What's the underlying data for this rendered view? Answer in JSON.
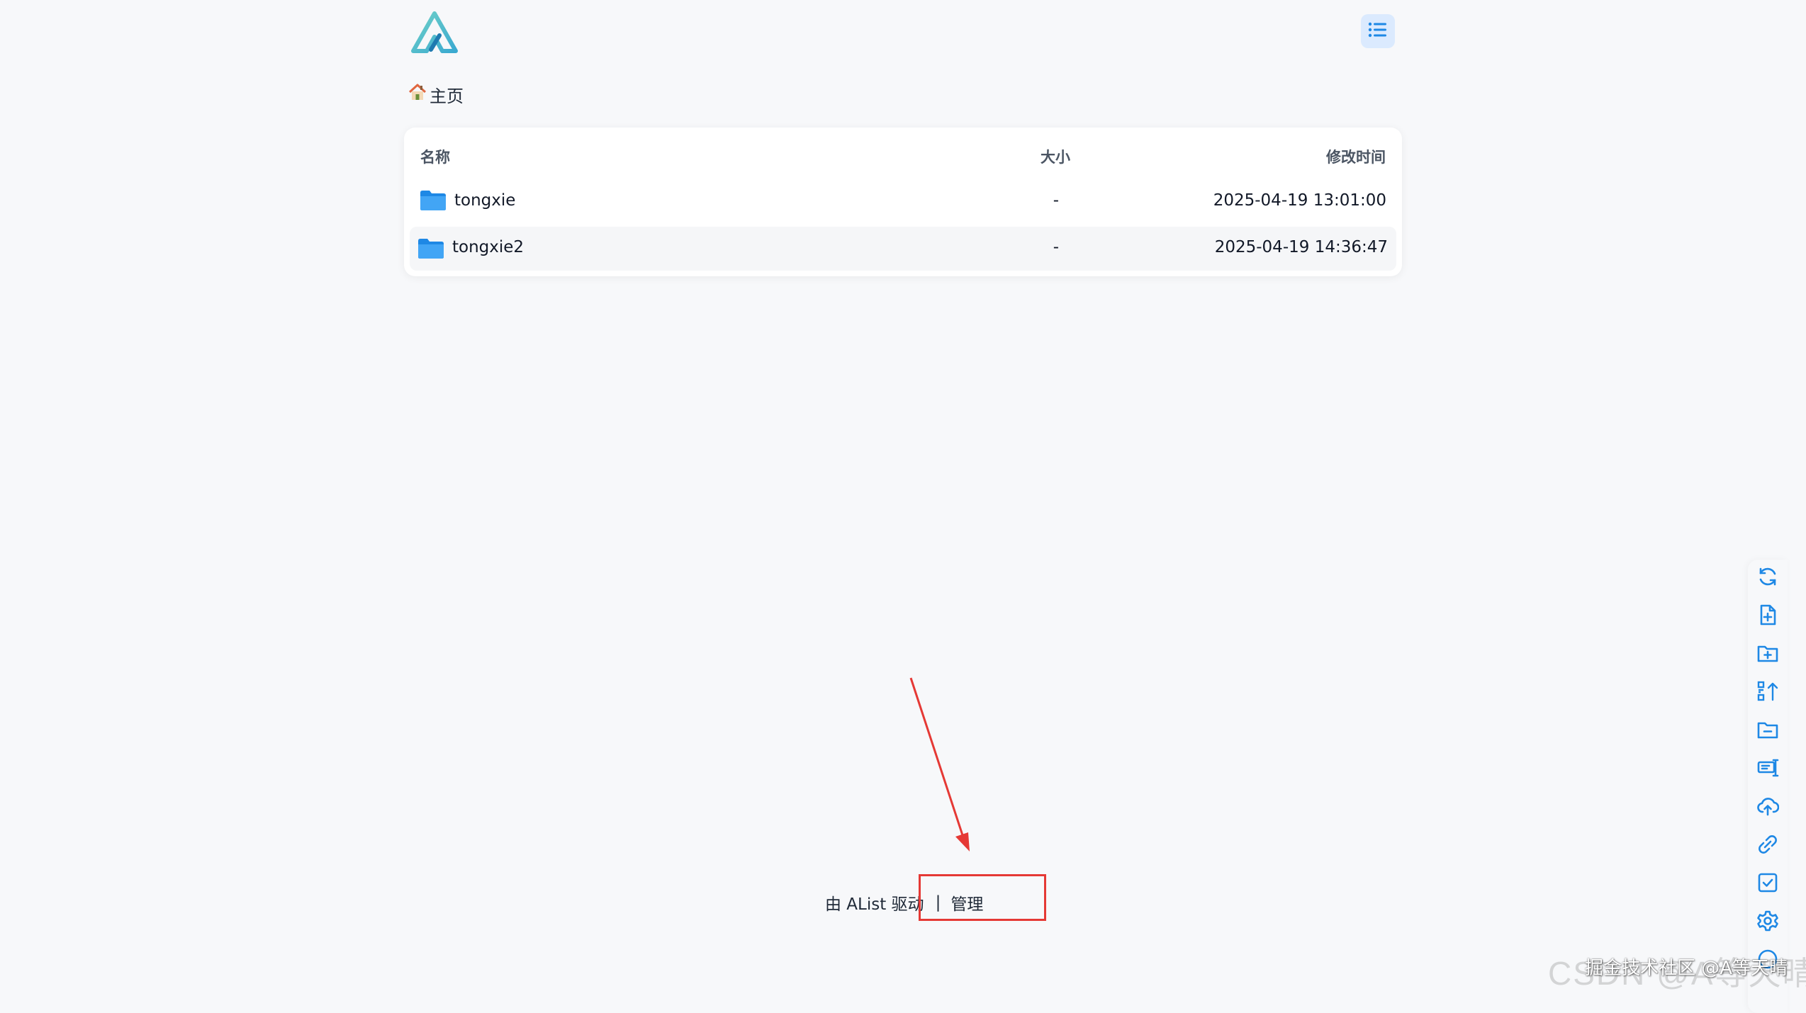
{
  "header": {
    "logo_icon": "alist-logo-icon",
    "layout_toggle_icon": "list-view-icon"
  },
  "breadcrumb": {
    "home_icon": "house-icon",
    "home_label": "主页"
  },
  "file_list": {
    "columns": {
      "name": "名称",
      "size": "大小",
      "modified": "修改时间"
    },
    "rows": [
      {
        "icon": "folder-icon",
        "name": "tongxie",
        "size": "-",
        "modified": "2025-04-19 13:01:00"
      },
      {
        "icon": "folder-icon",
        "name": "tongxie2",
        "size": "-",
        "modified": "2025-04-19 14:36:47"
      }
    ]
  },
  "footer": {
    "powered_by": "由 AList 驱动",
    "separator": "|",
    "admin_link": "管理"
  },
  "toolbar": {
    "items": [
      "refresh-icon",
      "new-file-icon",
      "new-folder-icon",
      "recursive-move-icon",
      "remove-empty-folder-icon",
      "batch-rename-icon",
      "upload-icon",
      "offline-download-icon",
      "checkbox-select-icon",
      "settings-icon",
      "more-icon"
    ]
  },
  "watermark": {
    "csdn": "CSDN @A等天晴",
    "juejin": "掘金技术社区 @A等天晴"
  },
  "colors": {
    "background": "#f7f8fa",
    "accent": "#1e88e5",
    "folder": "#2196f3",
    "annotation_red": "#e53935",
    "logo_teal": "#5ec4c1"
  }
}
